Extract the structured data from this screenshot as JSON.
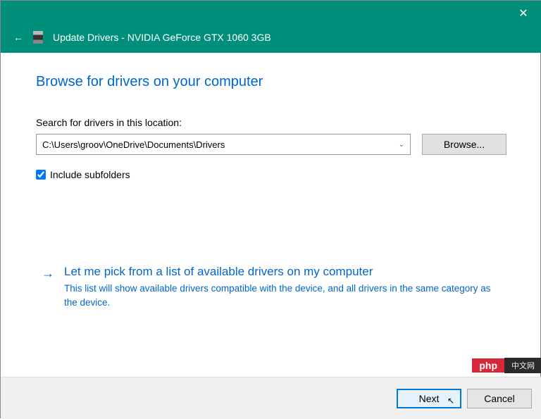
{
  "titlebar": {
    "close_label": "✕"
  },
  "header": {
    "back_label": "←",
    "title": "Update Drivers - NVIDIA GeForce GTX 1060 3GB"
  },
  "main": {
    "heading": "Browse for drivers on your computer",
    "search_label": "Search for drivers in this location:",
    "path_value": "C:\\Users\\groov\\OneDrive\\Documents\\Drivers",
    "browse_label": "Browse...",
    "include_subfolders_label": "Include subfolders",
    "include_subfolders_checked": true,
    "pick_arrow": "→",
    "pick_title": "Let me pick from a list of available drivers on my computer",
    "pick_desc": "This list will show available drivers compatible with the device, and all drivers in the same category as the device."
  },
  "footer": {
    "next_label": "Next",
    "cancel_label": "Cancel"
  },
  "watermark": {
    "left": "php",
    "right": "中文网"
  }
}
